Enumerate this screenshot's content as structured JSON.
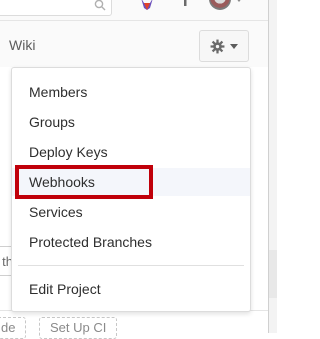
{
  "header": {
    "search": {
      "placeholder": ""
    },
    "icons": [
      "search-icon",
      "fox-icon",
      "plus-icon",
      "avatar",
      "chevron-down-icon"
    ]
  },
  "subnav": {
    "wiki_label": "Wiki"
  },
  "settings_button": {
    "icon": "gear-icon"
  },
  "dropdown": {
    "items": [
      {
        "label": "Members"
      },
      {
        "label": "Groups"
      },
      {
        "label": "Deploy Keys"
      },
      {
        "label": "Webhooks",
        "highlighted": true
      },
      {
        "label": "Services"
      },
      {
        "label": "Protected Branches"
      }
    ],
    "footer_item": {
      "label": "Edit Project"
    }
  },
  "background": {
    "input_fragment": "th",
    "bottom_buttons": [
      {
        "label": "de"
      },
      {
        "label": "Set Up CI"
      }
    ]
  },
  "colors": {
    "highlight": "#c0000a",
    "hover_row": "#f4f6fb"
  }
}
